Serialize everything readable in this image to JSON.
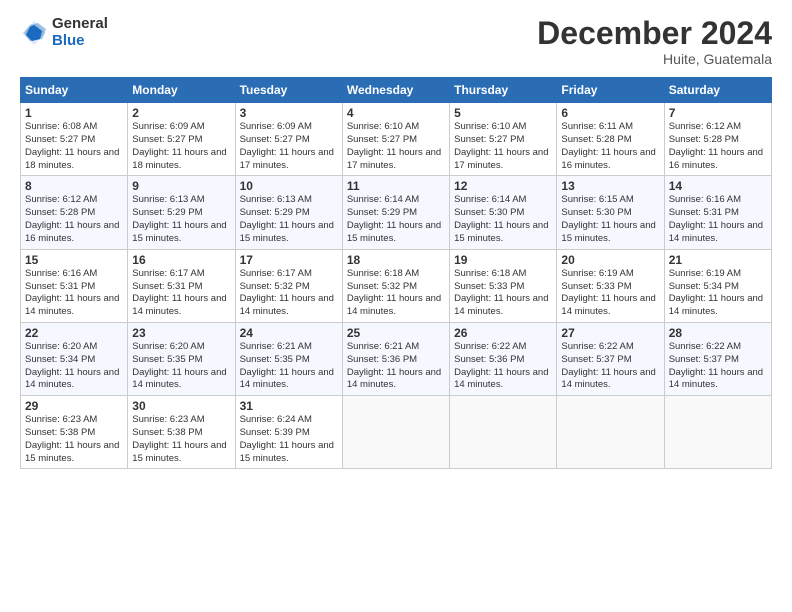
{
  "logo": {
    "general": "General",
    "blue": "Blue"
  },
  "title": "December 2024",
  "location": "Huite, Guatemala",
  "weekdays": [
    "Sunday",
    "Monday",
    "Tuesday",
    "Wednesday",
    "Thursday",
    "Friday",
    "Saturday"
  ],
  "weeks": [
    [
      {
        "day": "1",
        "sunrise": "6:08 AM",
        "sunset": "5:27 PM",
        "daylight": "11 hours and 18 minutes."
      },
      {
        "day": "2",
        "sunrise": "6:09 AM",
        "sunset": "5:27 PM",
        "daylight": "11 hours and 18 minutes."
      },
      {
        "day": "3",
        "sunrise": "6:09 AM",
        "sunset": "5:27 PM",
        "daylight": "11 hours and 17 minutes."
      },
      {
        "day": "4",
        "sunrise": "6:10 AM",
        "sunset": "5:27 PM",
        "daylight": "11 hours and 17 minutes."
      },
      {
        "day": "5",
        "sunrise": "6:10 AM",
        "sunset": "5:27 PM",
        "daylight": "11 hours and 17 minutes."
      },
      {
        "day": "6",
        "sunrise": "6:11 AM",
        "sunset": "5:28 PM",
        "daylight": "11 hours and 16 minutes."
      },
      {
        "day": "7",
        "sunrise": "6:12 AM",
        "sunset": "5:28 PM",
        "daylight": "11 hours and 16 minutes."
      }
    ],
    [
      {
        "day": "8",
        "sunrise": "6:12 AM",
        "sunset": "5:28 PM",
        "daylight": "11 hours and 16 minutes."
      },
      {
        "day": "9",
        "sunrise": "6:13 AM",
        "sunset": "5:29 PM",
        "daylight": "11 hours and 15 minutes."
      },
      {
        "day": "10",
        "sunrise": "6:13 AM",
        "sunset": "5:29 PM",
        "daylight": "11 hours and 15 minutes."
      },
      {
        "day": "11",
        "sunrise": "6:14 AM",
        "sunset": "5:29 PM",
        "daylight": "11 hours and 15 minutes."
      },
      {
        "day": "12",
        "sunrise": "6:14 AM",
        "sunset": "5:30 PM",
        "daylight": "11 hours and 15 minutes."
      },
      {
        "day": "13",
        "sunrise": "6:15 AM",
        "sunset": "5:30 PM",
        "daylight": "11 hours and 15 minutes."
      },
      {
        "day": "14",
        "sunrise": "6:16 AM",
        "sunset": "5:31 PM",
        "daylight": "11 hours and 14 minutes."
      }
    ],
    [
      {
        "day": "15",
        "sunrise": "6:16 AM",
        "sunset": "5:31 PM",
        "daylight": "11 hours and 14 minutes."
      },
      {
        "day": "16",
        "sunrise": "6:17 AM",
        "sunset": "5:31 PM",
        "daylight": "11 hours and 14 minutes."
      },
      {
        "day": "17",
        "sunrise": "6:17 AM",
        "sunset": "5:32 PM",
        "daylight": "11 hours and 14 minutes."
      },
      {
        "day": "18",
        "sunrise": "6:18 AM",
        "sunset": "5:32 PM",
        "daylight": "11 hours and 14 minutes."
      },
      {
        "day": "19",
        "sunrise": "6:18 AM",
        "sunset": "5:33 PM",
        "daylight": "11 hours and 14 minutes."
      },
      {
        "day": "20",
        "sunrise": "6:19 AM",
        "sunset": "5:33 PM",
        "daylight": "11 hours and 14 minutes."
      },
      {
        "day": "21",
        "sunrise": "6:19 AM",
        "sunset": "5:34 PM",
        "daylight": "11 hours and 14 minutes."
      }
    ],
    [
      {
        "day": "22",
        "sunrise": "6:20 AM",
        "sunset": "5:34 PM",
        "daylight": "11 hours and 14 minutes."
      },
      {
        "day": "23",
        "sunrise": "6:20 AM",
        "sunset": "5:35 PM",
        "daylight": "11 hours and 14 minutes."
      },
      {
        "day": "24",
        "sunrise": "6:21 AM",
        "sunset": "5:35 PM",
        "daylight": "11 hours and 14 minutes."
      },
      {
        "day": "25",
        "sunrise": "6:21 AM",
        "sunset": "5:36 PM",
        "daylight": "11 hours and 14 minutes."
      },
      {
        "day": "26",
        "sunrise": "6:22 AM",
        "sunset": "5:36 PM",
        "daylight": "11 hours and 14 minutes."
      },
      {
        "day": "27",
        "sunrise": "6:22 AM",
        "sunset": "5:37 PM",
        "daylight": "11 hours and 14 minutes."
      },
      {
        "day": "28",
        "sunrise": "6:22 AM",
        "sunset": "5:37 PM",
        "daylight": "11 hours and 14 minutes."
      }
    ],
    [
      {
        "day": "29",
        "sunrise": "6:23 AM",
        "sunset": "5:38 PM",
        "daylight": "11 hours and 15 minutes."
      },
      {
        "day": "30",
        "sunrise": "6:23 AM",
        "sunset": "5:38 PM",
        "daylight": "11 hours and 15 minutes."
      },
      {
        "day": "31",
        "sunrise": "6:24 AM",
        "sunset": "5:39 PM",
        "daylight": "11 hours and 15 minutes."
      },
      null,
      null,
      null,
      null
    ]
  ]
}
